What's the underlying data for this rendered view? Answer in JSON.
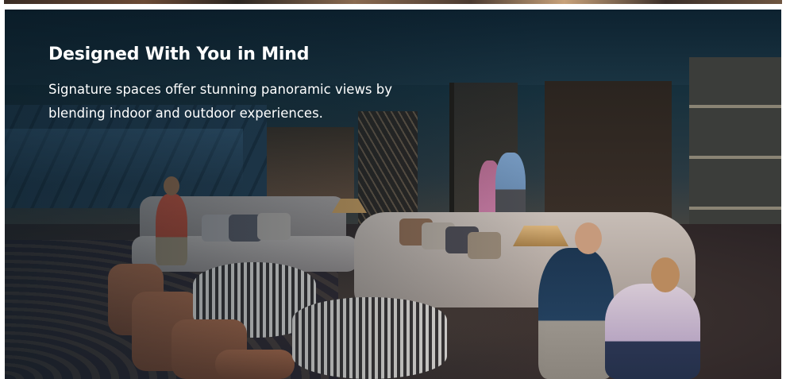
{
  "hero": {
    "title": "Designed With You in Mind",
    "description": "Signature spaces offer stunning panoramic views by blending indoor and outdoor experiences.",
    "image_subject": "lounge-interior"
  },
  "colors": {
    "text": "#ffffff",
    "background": "#ffffff"
  }
}
